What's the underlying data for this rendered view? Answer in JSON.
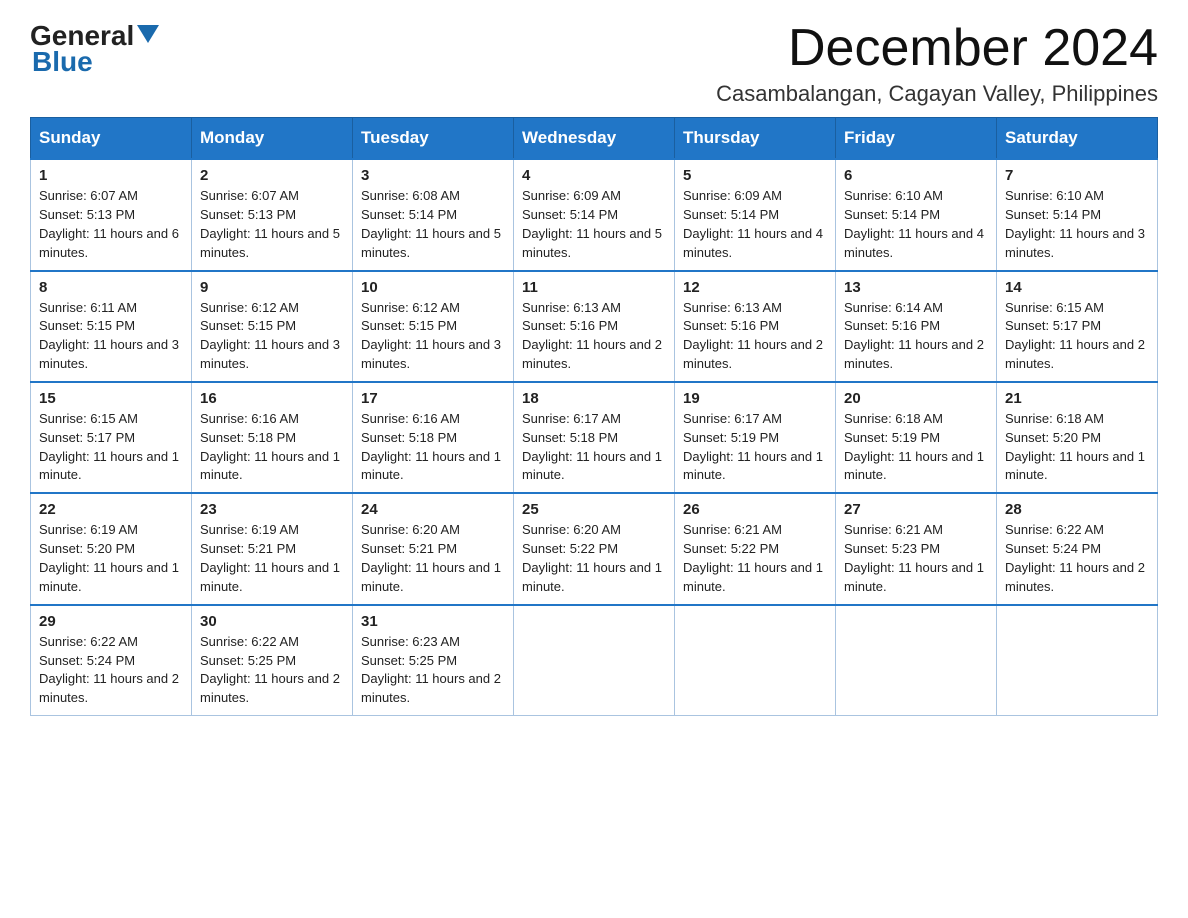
{
  "logo": {
    "line1": "General",
    "arrow": "▶",
    "line2": "Blue"
  },
  "header": {
    "month": "December 2024",
    "location": "Casambalangan, Cagayan Valley, Philippines"
  },
  "weekdays": [
    "Sunday",
    "Monday",
    "Tuesday",
    "Wednesday",
    "Thursday",
    "Friday",
    "Saturday"
  ],
  "weeks": [
    [
      {
        "day": "1",
        "sunrise": "6:07 AM",
        "sunset": "5:13 PM",
        "daylight": "11 hours and 6 minutes."
      },
      {
        "day": "2",
        "sunrise": "6:07 AM",
        "sunset": "5:13 PM",
        "daylight": "11 hours and 5 minutes."
      },
      {
        "day": "3",
        "sunrise": "6:08 AM",
        "sunset": "5:14 PM",
        "daylight": "11 hours and 5 minutes."
      },
      {
        "day": "4",
        "sunrise": "6:09 AM",
        "sunset": "5:14 PM",
        "daylight": "11 hours and 5 minutes."
      },
      {
        "day": "5",
        "sunrise": "6:09 AM",
        "sunset": "5:14 PM",
        "daylight": "11 hours and 4 minutes."
      },
      {
        "day": "6",
        "sunrise": "6:10 AM",
        "sunset": "5:14 PM",
        "daylight": "11 hours and 4 minutes."
      },
      {
        "day": "7",
        "sunrise": "6:10 AM",
        "sunset": "5:14 PM",
        "daylight": "11 hours and 3 minutes."
      }
    ],
    [
      {
        "day": "8",
        "sunrise": "6:11 AM",
        "sunset": "5:15 PM",
        "daylight": "11 hours and 3 minutes."
      },
      {
        "day": "9",
        "sunrise": "6:12 AM",
        "sunset": "5:15 PM",
        "daylight": "11 hours and 3 minutes."
      },
      {
        "day": "10",
        "sunrise": "6:12 AM",
        "sunset": "5:15 PM",
        "daylight": "11 hours and 3 minutes."
      },
      {
        "day": "11",
        "sunrise": "6:13 AM",
        "sunset": "5:16 PM",
        "daylight": "11 hours and 2 minutes."
      },
      {
        "day": "12",
        "sunrise": "6:13 AM",
        "sunset": "5:16 PM",
        "daylight": "11 hours and 2 minutes."
      },
      {
        "day": "13",
        "sunrise": "6:14 AM",
        "sunset": "5:16 PM",
        "daylight": "11 hours and 2 minutes."
      },
      {
        "day": "14",
        "sunrise": "6:15 AM",
        "sunset": "5:17 PM",
        "daylight": "11 hours and 2 minutes."
      }
    ],
    [
      {
        "day": "15",
        "sunrise": "6:15 AM",
        "sunset": "5:17 PM",
        "daylight": "11 hours and 1 minute."
      },
      {
        "day": "16",
        "sunrise": "6:16 AM",
        "sunset": "5:18 PM",
        "daylight": "11 hours and 1 minute."
      },
      {
        "day": "17",
        "sunrise": "6:16 AM",
        "sunset": "5:18 PM",
        "daylight": "11 hours and 1 minute."
      },
      {
        "day": "18",
        "sunrise": "6:17 AM",
        "sunset": "5:18 PM",
        "daylight": "11 hours and 1 minute."
      },
      {
        "day": "19",
        "sunrise": "6:17 AM",
        "sunset": "5:19 PM",
        "daylight": "11 hours and 1 minute."
      },
      {
        "day": "20",
        "sunrise": "6:18 AM",
        "sunset": "5:19 PM",
        "daylight": "11 hours and 1 minute."
      },
      {
        "day": "21",
        "sunrise": "6:18 AM",
        "sunset": "5:20 PM",
        "daylight": "11 hours and 1 minute."
      }
    ],
    [
      {
        "day": "22",
        "sunrise": "6:19 AM",
        "sunset": "5:20 PM",
        "daylight": "11 hours and 1 minute."
      },
      {
        "day": "23",
        "sunrise": "6:19 AM",
        "sunset": "5:21 PM",
        "daylight": "11 hours and 1 minute."
      },
      {
        "day": "24",
        "sunrise": "6:20 AM",
        "sunset": "5:21 PM",
        "daylight": "11 hours and 1 minute."
      },
      {
        "day": "25",
        "sunrise": "6:20 AM",
        "sunset": "5:22 PM",
        "daylight": "11 hours and 1 minute."
      },
      {
        "day": "26",
        "sunrise": "6:21 AM",
        "sunset": "5:22 PM",
        "daylight": "11 hours and 1 minute."
      },
      {
        "day": "27",
        "sunrise": "6:21 AM",
        "sunset": "5:23 PM",
        "daylight": "11 hours and 1 minute."
      },
      {
        "day": "28",
        "sunrise": "6:22 AM",
        "sunset": "5:24 PM",
        "daylight": "11 hours and 2 minutes."
      }
    ],
    [
      {
        "day": "29",
        "sunrise": "6:22 AM",
        "sunset": "5:24 PM",
        "daylight": "11 hours and 2 minutes."
      },
      {
        "day": "30",
        "sunrise": "6:22 AM",
        "sunset": "5:25 PM",
        "daylight": "11 hours and 2 minutes."
      },
      {
        "day": "31",
        "sunrise": "6:23 AM",
        "sunset": "5:25 PM",
        "daylight": "11 hours and 2 minutes."
      },
      null,
      null,
      null,
      null
    ]
  ],
  "labels": {
    "sunrise_prefix": "Sunrise: ",
    "sunset_prefix": "Sunset: ",
    "daylight_prefix": "Daylight: "
  }
}
